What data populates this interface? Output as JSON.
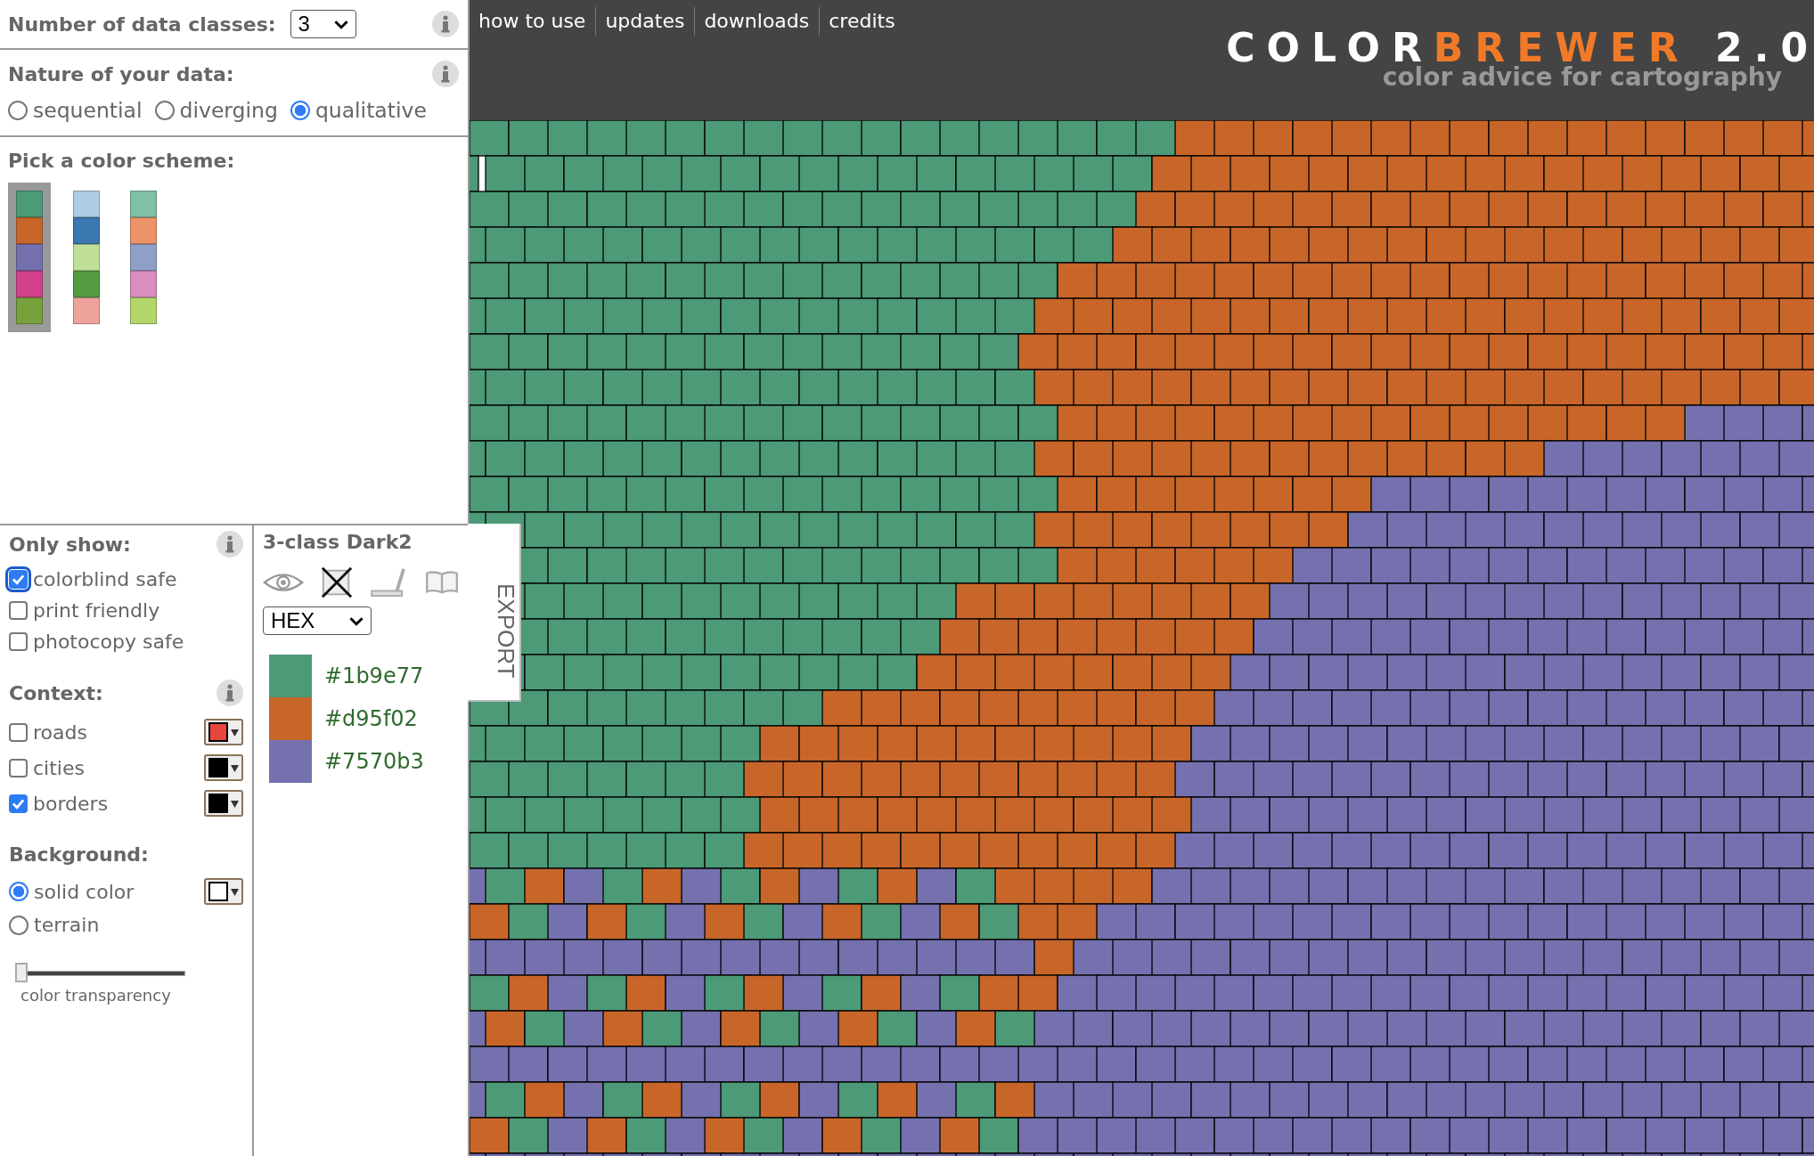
{
  "classes": {
    "label": "Number of data classes:",
    "value": "3"
  },
  "nature": {
    "label": "Nature of your data:",
    "options": [
      {
        "label": "sequential",
        "selected": false
      },
      {
        "label": "diverging",
        "selected": false
      },
      {
        "label": "qualitative",
        "selected": true
      }
    ]
  },
  "schemes": {
    "label": "Pick a color scheme:",
    "items": [
      {
        "selected": true,
        "colors": [
          {
            "color": "#4c9a77"
          },
          {
            "color": "#c8662a"
          },
          {
            "color": "#7471ae"
          },
          {
            "color": "#d3418a"
          },
          {
            "color": "#78a03c"
          }
        ]
      },
      {
        "selected": false,
        "colors": [
          {
            "color": "#aecde2"
          },
          {
            "color": "#3b77b0"
          },
          {
            "color": "#bfdf96"
          },
          {
            "color": "#549c40"
          },
          {
            "color": "#eda39c"
          }
        ]
      },
      {
        "selected": false,
        "colors": [
          {
            "color": "#80c0a5"
          },
          {
            "color": "#ec9269"
          },
          {
            "color": "#8f9fc8"
          },
          {
            "color": "#da8ec0"
          },
          {
            "color": "#b2d66a"
          }
        ]
      }
    ]
  },
  "only_show": {
    "label": "Only show:",
    "options": [
      {
        "label": "colorblind safe",
        "checked": true
      },
      {
        "label": "print friendly",
        "checked": false
      },
      {
        "label": "photocopy safe",
        "checked": false
      }
    ]
  },
  "context": {
    "label": "Context:",
    "options": [
      {
        "label": "roads",
        "checked": false,
        "color": "#e8463c"
      },
      {
        "label": "cities",
        "checked": false,
        "color": "#000000"
      },
      {
        "label": "borders",
        "checked": true,
        "color": "#000000"
      }
    ]
  },
  "background": {
    "label": "Background:",
    "options": [
      {
        "label": "solid color",
        "selected": true,
        "color": "#ffffff"
      },
      {
        "label": "terrain",
        "selected": false
      }
    ],
    "slider": {
      "level": 0,
      "label": "color transparency"
    }
  },
  "legend": {
    "title": "3-class Dark2",
    "format": "HEX",
    "export": "EXPORT",
    "items": [
      {
        "hex": "#1b9e77",
        "color": "#4c9a77"
      },
      {
        "hex": "#d95f02",
        "color": "#c8662a"
      },
      {
        "hex": "#7570b3",
        "color": "#7471ae"
      }
    ]
  },
  "nav": [
    "how to use",
    "updates",
    "downloads",
    "credits"
  ],
  "logo": {
    "parts": [
      {
        "text": "COLOR",
        "kind": "plain"
      },
      {
        "text": "BREWER",
        "kind": "accent"
      }
    ],
    "version": "2.0",
    "tagline": "color advice for cartography"
  }
}
